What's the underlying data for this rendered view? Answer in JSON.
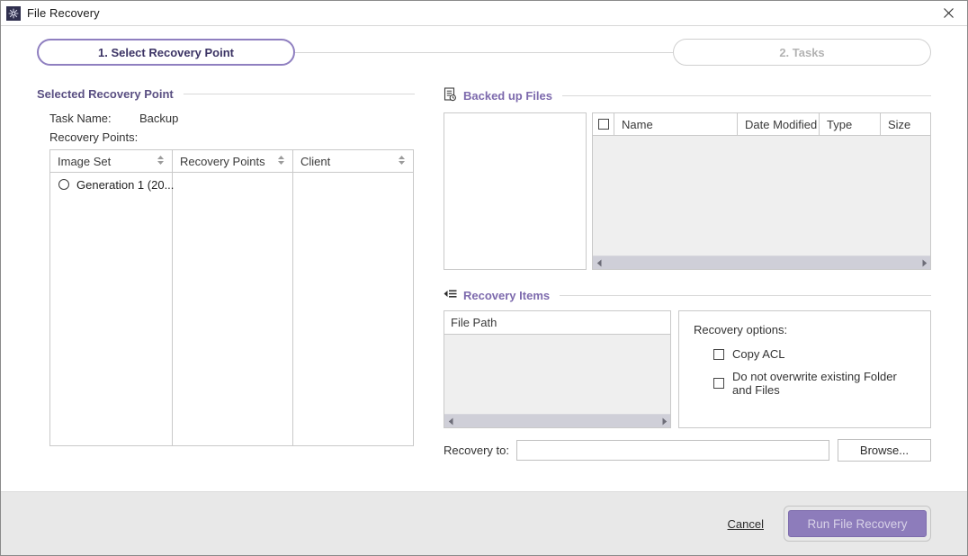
{
  "window": {
    "title": "File Recovery",
    "app_icon": "snowflake-app-icon",
    "close_label": "✕"
  },
  "stepper": {
    "steps": [
      {
        "label": "1. Select Recovery Point",
        "state": "active"
      },
      {
        "label": "2. Tasks",
        "state": "inactive"
      }
    ]
  },
  "left_panel": {
    "section_title": "Selected Recovery Point",
    "task_name_label": "Task Name:",
    "task_name_value": "Backup",
    "recovery_points_label": "Recovery Points:",
    "table": {
      "columns": [
        "Image Set",
        "Recovery Points",
        "Client"
      ],
      "rows": [
        {
          "image_set": "Generation 1 (20...",
          "recovery_points": "",
          "client": ""
        }
      ]
    }
  },
  "backed_up_files": {
    "section_title": "Backed up Files",
    "icon": "document-clock-icon",
    "columns": [
      "Name",
      "Date Modified",
      "Type",
      "Size"
    ],
    "select_all_checked": false,
    "rows": []
  },
  "recovery_items": {
    "section_title": "Recovery Items",
    "icon": "list-indent-icon",
    "column": "File Path",
    "rows": [],
    "options": {
      "title": "Recovery options:",
      "items": [
        {
          "label": "Copy ACL",
          "checked": false
        },
        {
          "label": "Do not overwrite existing Folder and Files",
          "checked": false
        }
      ]
    }
  },
  "recovery_to": {
    "label": "Recovery to:",
    "value": "",
    "placeholder": "",
    "browse_label": "Browse..."
  },
  "footer": {
    "cancel_label": "Cancel",
    "run_label": "Run File Recovery"
  },
  "colors": {
    "accent_purple": "#7d6aad",
    "step_active_border": "#8f7fc0",
    "run_button": "#8d7cbb",
    "grid_body": "#efefef",
    "footer_bg": "#e8e8e8"
  }
}
